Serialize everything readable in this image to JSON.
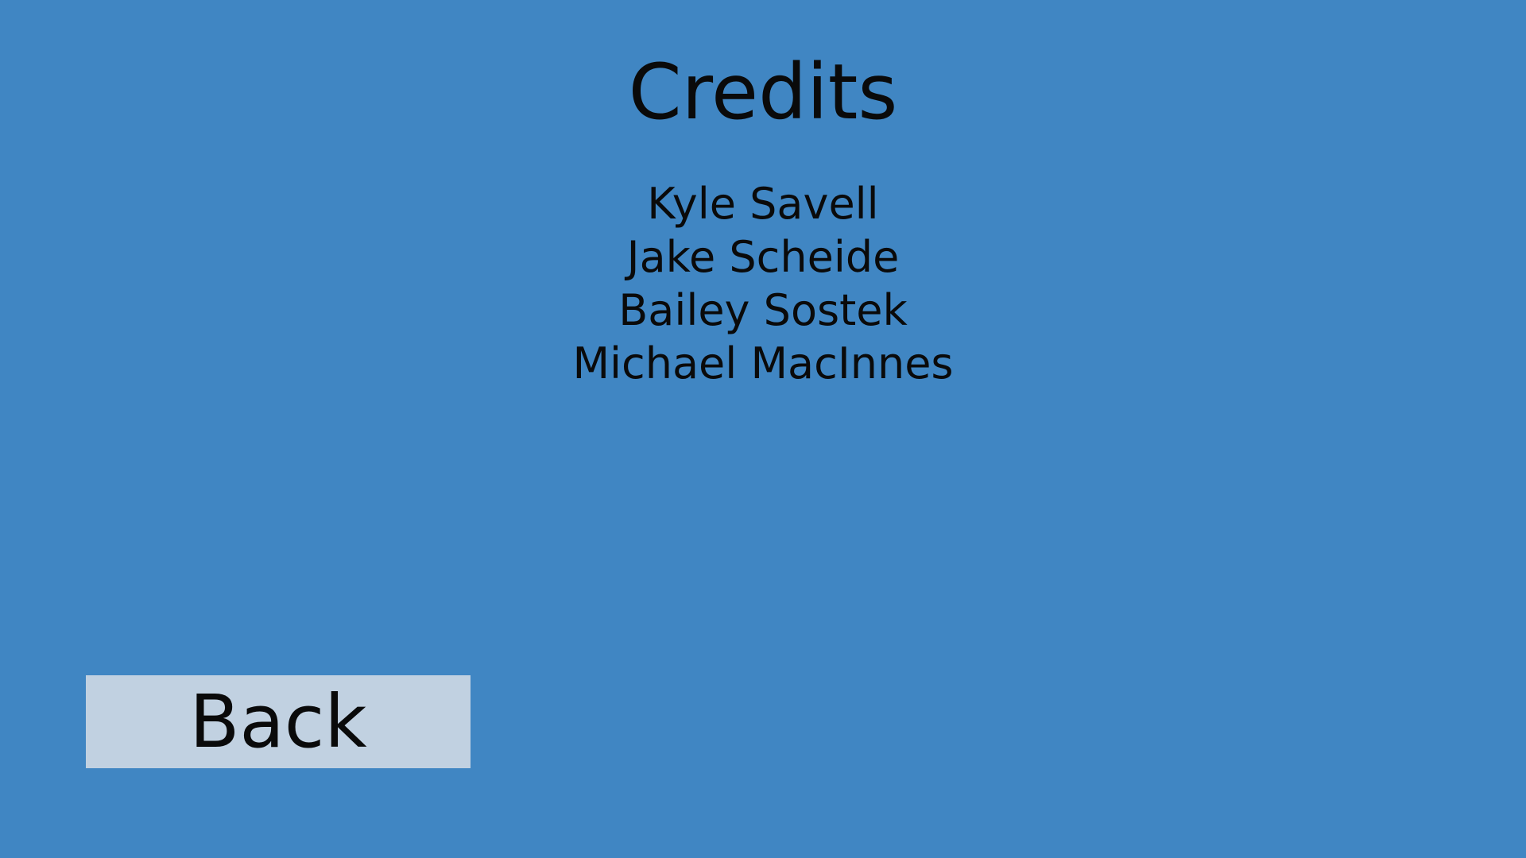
{
  "screen": {
    "title": "Credits",
    "background_color": "#4086c3"
  },
  "credits": {
    "names": [
      "Kyle Savell",
      "Jake Scheide",
      "Bailey Sostek",
      "Michael MacInnes"
    ]
  },
  "buttons": {
    "back_label": "Back",
    "back_color": "#c1d1e1"
  }
}
